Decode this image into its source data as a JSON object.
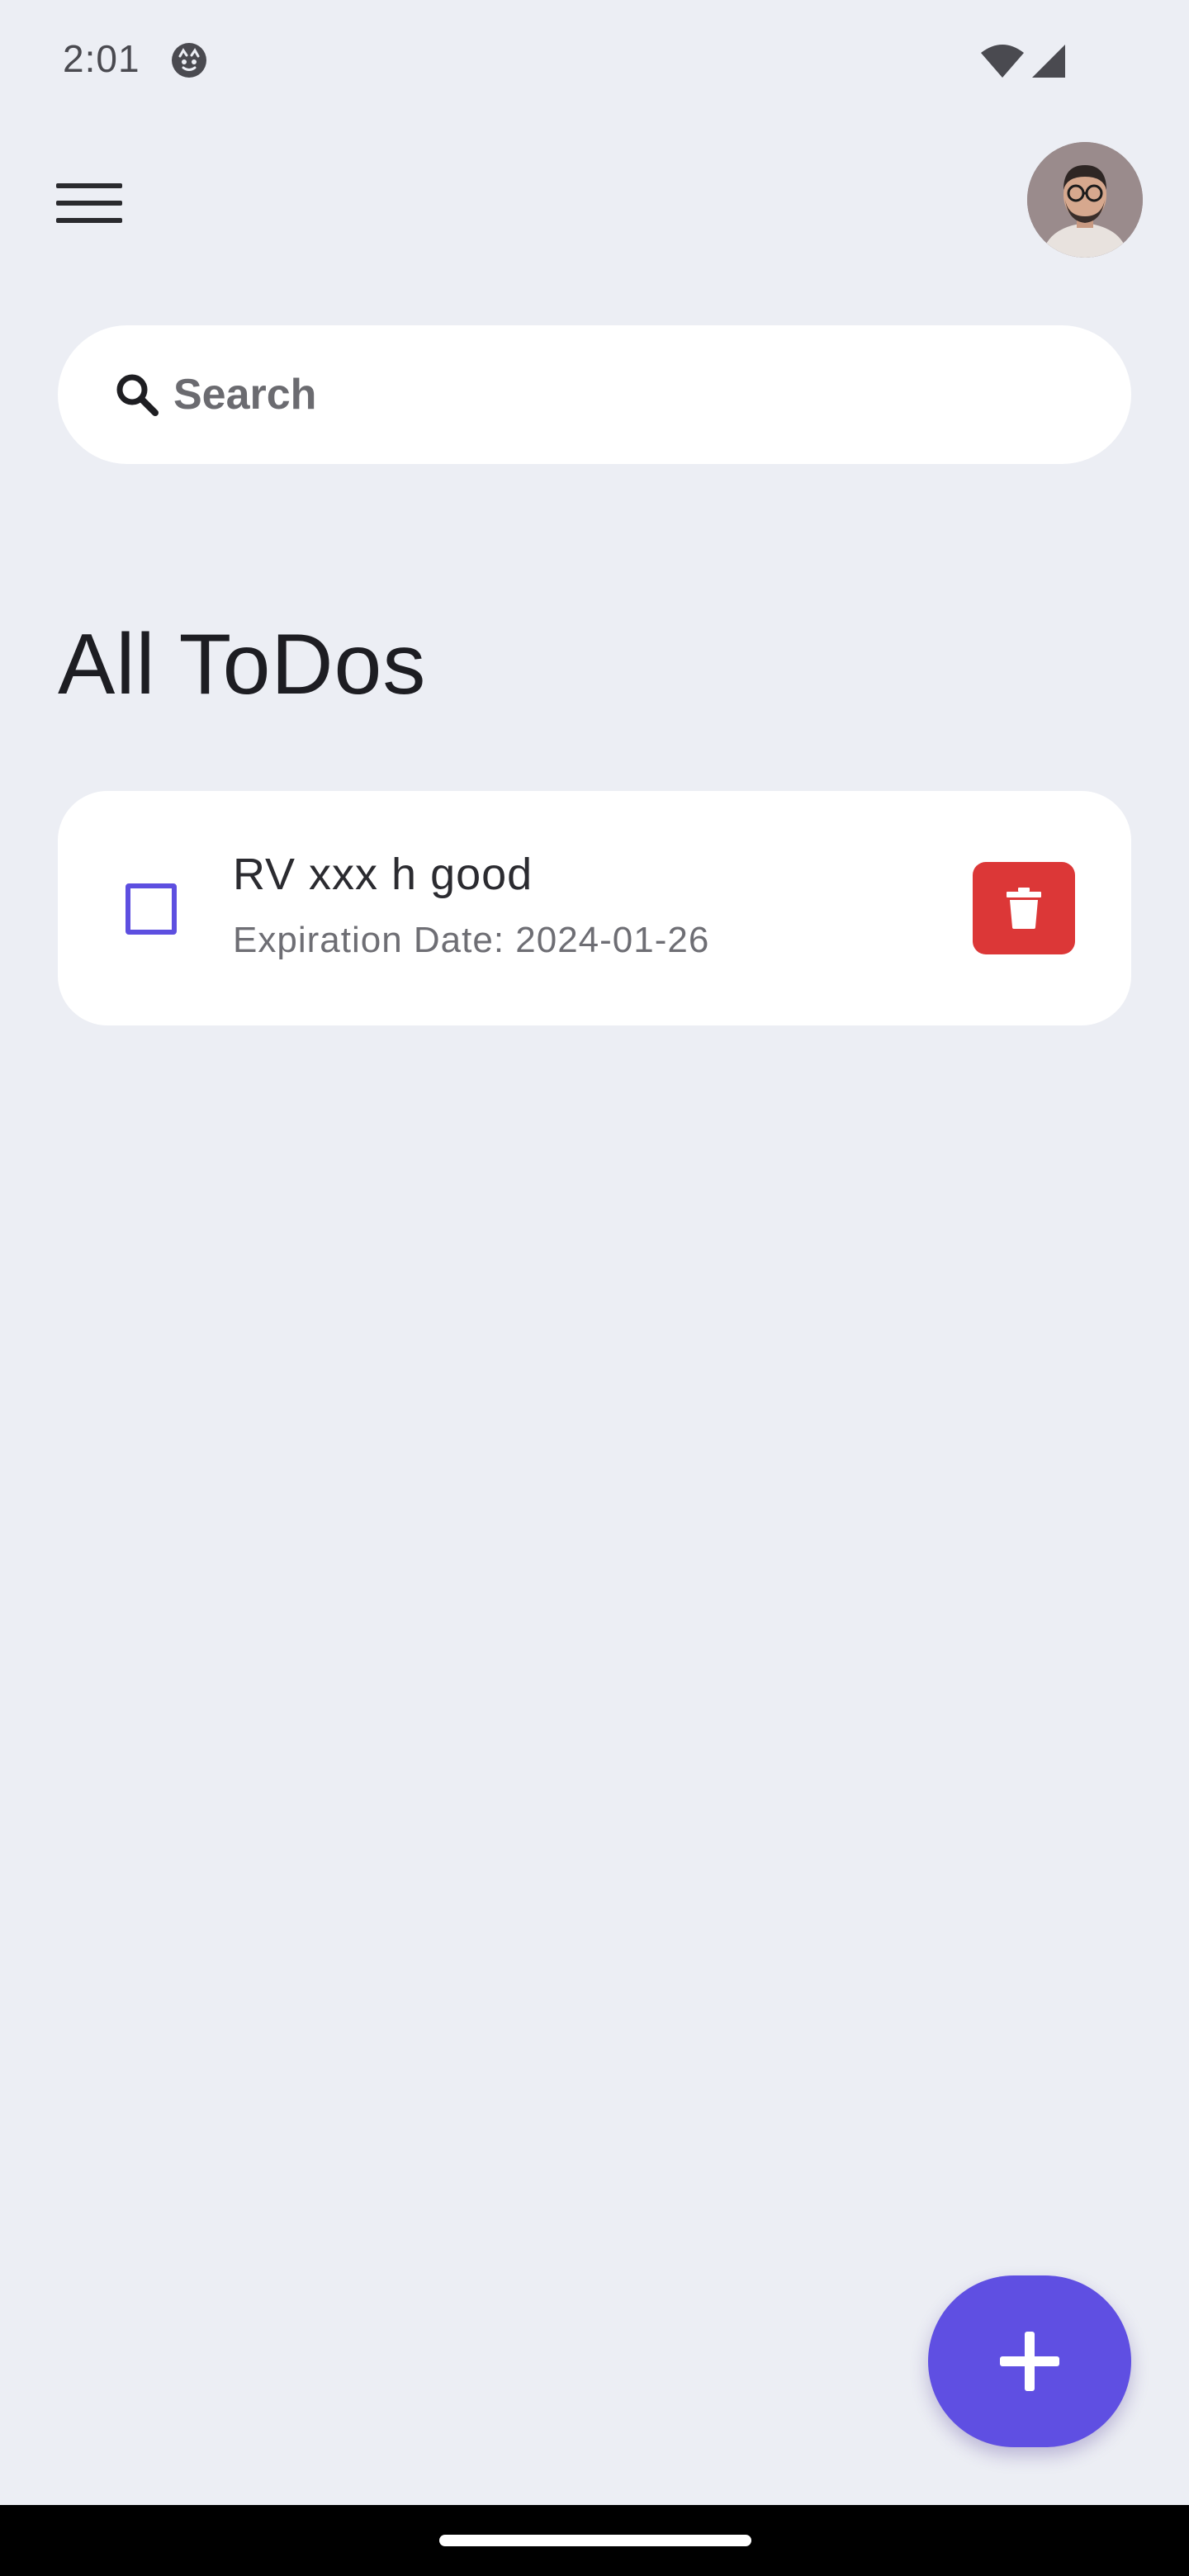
{
  "status_bar": {
    "time": "2:01",
    "icons": [
      "notification-icon",
      "wifi-icon",
      "signal-icon"
    ]
  },
  "app_bar": {
    "menu_icon": "hamburger-menu-icon",
    "avatar_icon": "user-avatar"
  },
  "search": {
    "placeholder": "Search",
    "value": "",
    "icon": "search-icon"
  },
  "page": {
    "title": "All ToDos"
  },
  "todos": [
    {
      "title": "RV xxx h good",
      "expiration": "Expiration Date: 2024-01-26",
      "checked": false,
      "delete_icon": "trash-icon"
    }
  ],
  "fab": {
    "icon": "plus-icon"
  },
  "colors": {
    "background": "#eceef4",
    "card": "#ffffff",
    "accent": "#5f4fe2",
    "delete": "#dc3737",
    "checkbox": "#5d4fe0"
  }
}
